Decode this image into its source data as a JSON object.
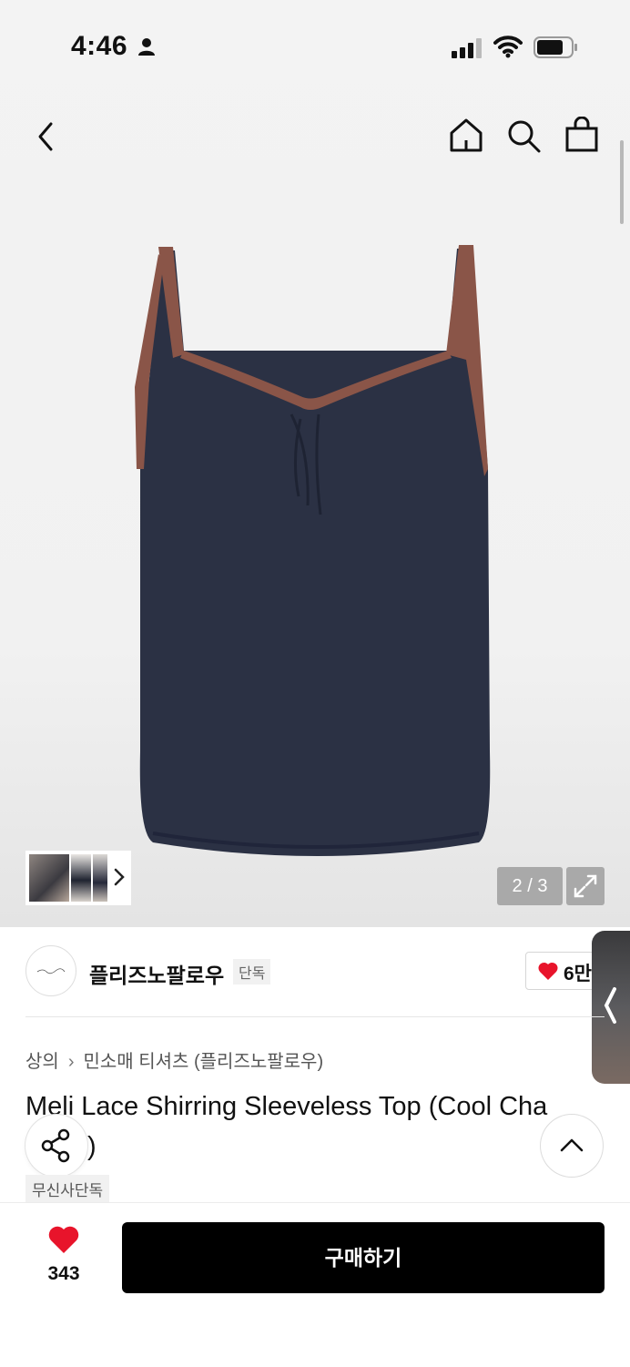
{
  "status_bar": {
    "time": "4:46",
    "icons": [
      "person-icon",
      "signal-icon",
      "wifi-icon",
      "battery-icon"
    ]
  },
  "header": {
    "icons": [
      "back-icon",
      "home-icon",
      "search-icon",
      "bag-icon"
    ]
  },
  "gallery": {
    "page_counter": "2 / 3",
    "current_index": 2,
    "total": 3,
    "product_colors": {
      "body": "#2a3042",
      "lace": "#8a5548"
    }
  },
  "brand": {
    "name": "플리즈노팔로우",
    "exclusive_badge": "단독",
    "like_count": "6만"
  },
  "breadcrumb": {
    "category": "상의",
    "subcategory": "민소매 티셔츠 (플리즈노팔로우)"
  },
  "product": {
    "title": "Meli Lace Shirring Sleeveless Top (Cool Cha",
    "title_line2": ")",
    "badge": "무신사단독"
  },
  "bottom_bar": {
    "like_count": "343",
    "buy_label": "구매하기"
  },
  "colors": {
    "accent_heart": "#e8142b",
    "buy_button": "#000000"
  }
}
